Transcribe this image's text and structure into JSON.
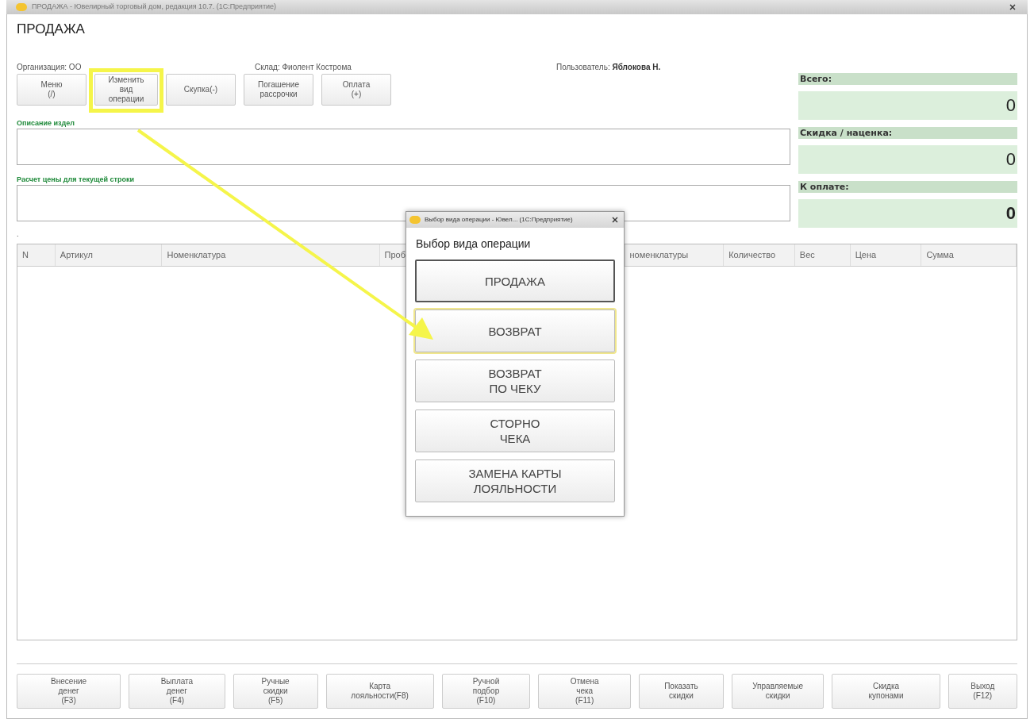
{
  "window": {
    "title": "ПРОДАЖА - Ювелирный торговый дом, редакция 10.7. (1С:Предприятие)"
  },
  "form": {
    "title": "ПРОДАЖА",
    "organization": "Организация: ОО",
    "warehouse_label": "Склад:",
    "warehouse": "Фиолент Кострома",
    "user_label": "Пользователь:",
    "user": "Яблокова Н."
  },
  "top_buttons": [
    {
      "label": "Меню\n(/)"
    },
    {
      "label": "Изменить\nвид\nоперации"
    },
    {
      "label": "Скупка(-)"
    },
    {
      "label": "Погашение\nрассрочки"
    },
    {
      "label": "Оплата\n(+)"
    }
  ],
  "description_label": "Описание издел",
  "price_label": "Расчет цены для текущей строки",
  "dot": ".",
  "totals": [
    {
      "label": "Всего:",
      "value": "0",
      "bold": false
    },
    {
      "label": "Скидка / наценка:",
      "value": "0",
      "bold": false
    },
    {
      "label": "К оплате:",
      "value": "0",
      "bold": true
    }
  ],
  "table": {
    "columns": [
      "N",
      "Артикул",
      "Номенклатура",
      "Проб",
      "номенклатуры",
      "Количество",
      "Вес",
      "Цена",
      "Сумма"
    ]
  },
  "bottom_buttons": [
    {
      "label": "Внесение\nденег\n(F3)"
    },
    {
      "label": "Выплата\nденег\n(F4)"
    },
    {
      "label": "Ручные\nскидки\n(F5)"
    },
    {
      "label": "Карта\nлояльности(F8)"
    },
    {
      "label": "Ручной\nподбор\n(F10)"
    },
    {
      "label": "Отмена\nчека\n(F11)"
    },
    {
      "label": "Показать\nскидки"
    },
    {
      "label": "Управляемые\nскидки"
    },
    {
      "label": "Скидка\nкупонами"
    },
    {
      "label": "Выход\n(F12)"
    }
  ],
  "dialog": {
    "title": "Выбор вида операции - Ювел... (1С:Предприятие)",
    "heading": "Выбор вида операции",
    "options": [
      {
        "label": "ПРОДАЖА",
        "selected": true,
        "highlighted": false
      },
      {
        "label": "ВОЗВРАТ",
        "selected": false,
        "highlighted": true
      },
      {
        "label": "ВОЗВРАТ\nПО ЧЕКУ",
        "selected": false,
        "highlighted": false
      },
      {
        "label": "СТОРНО\nЧЕКА",
        "selected": false,
        "highlighted": false
      },
      {
        "label": "ЗАМЕНА КАРТЫ\nЛОЯЛЬНОСТИ",
        "selected": false,
        "highlighted": false
      }
    ]
  }
}
